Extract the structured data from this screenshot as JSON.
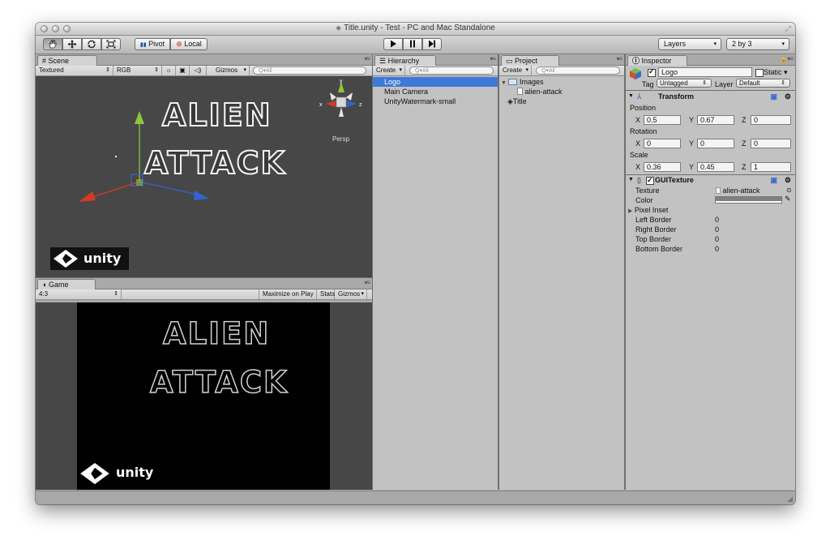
{
  "window": {
    "title": "Title.unity - Test - PC and Mac Standalone"
  },
  "toolbar": {
    "pivot_label": "Pivot",
    "local_label": "Local",
    "layers_label": "Layers",
    "layout_label": "2 by 3"
  },
  "scene": {
    "tab_label": "Scene",
    "render_mode": "Textured",
    "color_mode": "RGB",
    "gizmos_label": "Gizmos",
    "search_placeholder": "Q▾All",
    "persp_label": "Persp",
    "gizmo_axes": {
      "x": "x",
      "y": "y",
      "z": "z"
    },
    "title_line1": "ALIEN",
    "title_line2": "ATTACK",
    "watermark_text": "unity"
  },
  "game": {
    "tab_label": "Game",
    "aspect": "4:3",
    "maximize_label": "Maximize on Play",
    "stats_label": "Stats",
    "gizmos_label": "Gizmos",
    "title_line1": "ALIEN",
    "title_line2": "ATTACK",
    "watermark_text": "unity"
  },
  "hierarchy": {
    "tab_label": "Hierarchy",
    "create_label": "Create",
    "search_placeholder": "Q▾All",
    "items": [
      {
        "label": "Logo",
        "selected": true
      },
      {
        "label": "Main Camera",
        "selected": false
      },
      {
        "label": "UnityWatermark-small",
        "selected": false
      }
    ]
  },
  "project": {
    "tab_label": "Project",
    "create_label": "Create",
    "search_placeholder": "Q▾All",
    "items": [
      {
        "label": "Images",
        "type": "folder"
      },
      {
        "label": "alien-attack",
        "type": "texture"
      },
      {
        "label": "Title",
        "type": "scene"
      }
    ]
  },
  "inspector": {
    "tab_label": "Inspector",
    "object_name": "Logo",
    "static_label": "Static",
    "tag_label": "Tag",
    "tag_value": "Untagged",
    "layer_label": "Layer",
    "layer_value": "Default",
    "transform": {
      "title": "Transform",
      "position_label": "Position",
      "rotation_label": "Rotation",
      "scale_label": "Scale",
      "axis_x": "X",
      "axis_y": "Y",
      "axis_z": "Z",
      "position": {
        "x": "0.5",
        "y": "0.67",
        "z": "0"
      },
      "rotation": {
        "x": "0",
        "y": "0",
        "z": "0"
      },
      "scale": {
        "x": "0.36",
        "y": "0.45",
        "z": "1"
      }
    },
    "gui_texture": {
      "title": "GUITexture",
      "texture_label": "Texture",
      "texture_value": "alien-attack",
      "color_label": "Color",
      "color_value": "#808080",
      "pixel_inset_label": "Pixel Inset",
      "left_border_label": "Left Border",
      "left_border_value": "0",
      "right_border_label": "Right Border",
      "right_border_value": "0",
      "top_border_label": "Top Border",
      "top_border_value": "0",
      "bottom_border_label": "Bottom Border",
      "bottom_border_value": "0"
    }
  },
  "colors": {
    "selection": "#3d7ad7",
    "panel_bg": "#c2c2c2",
    "scene_bg": "#474747",
    "game_bg": "#000000"
  }
}
